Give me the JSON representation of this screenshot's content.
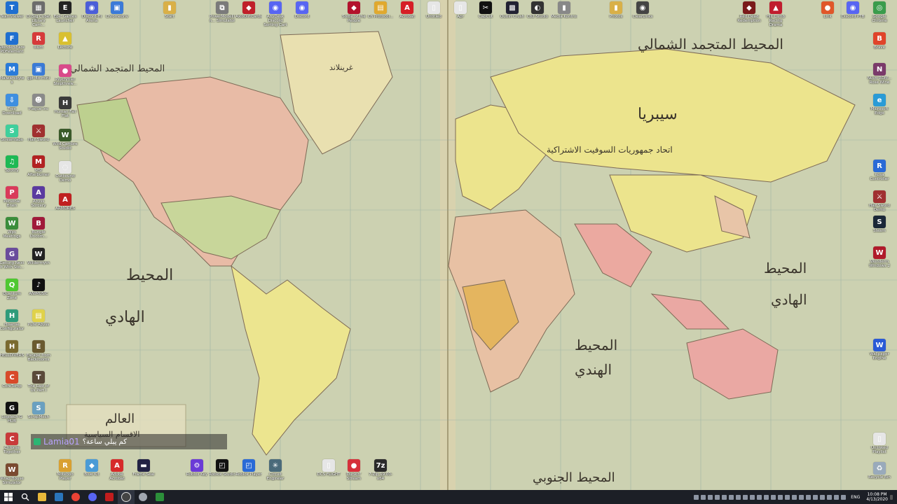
{
  "wallpaper": {
    "description_labels": {
      "north_atlantic": "المحيط المتجمد الشمالي",
      "north_atlantic_left": "المحيط المتجمد الشمالي",
      "greenland": "غرينلاند",
      "siberia": "سيبريا",
      "pacific_left_1": "المحيط",
      "pacific_left_2": "الهادي",
      "pacific_right_1": "المحيط",
      "pacific_right_2": "الهادي",
      "indian_1": "المحيط",
      "indian_2": "الهندي",
      "south_ocean": "المحيط الجنوبي",
      "title_1": "العالم",
      "title_2": "الاقسام السياسية",
      "ussr": "اتحاد جمهوريات السوفيت الاشتراكية"
    }
  },
  "desktop_icons_top": [
    {
      "label": "TeamViewer",
      "color": "#1f6fd0",
      "glyph": "T"
    },
    {
      "label": "D:\\Sig Cube\\ Library Cam...",
      "color": "#6c6c6c",
      "glyph": "▦"
    },
    {
      "label": "Epic Games Launcher",
      "color": "#222",
      "glyph": "E"
    },
    {
      "label": "Discord-Hi Arena",
      "color": "#4b5ed8",
      "glyph": "◉"
    },
    {
      "label": "Chromedriv",
      "color": "#3b7ad8",
      "glyph": "▣"
    },
    {
      "label": "Start",
      "color": "#d9b048",
      "glyph": "▮"
    },
    {
      "label": "PowerModellin... Simulator",
      "color": "#7a7a7a",
      "glyph": "⧉"
    },
    {
      "label": "AxioDirtCards",
      "color": "#c0202a",
      "glyph": "◆"
    },
    {
      "label": "AnyDesk Discord Sorting Cart",
      "color": "#5865f2",
      "glyph": "◉"
    },
    {
      "label": "Discord",
      "color": "#5865f2",
      "glyph": "◉"
    },
    {
      "label": "Some of the People",
      "color": "#b3122c",
      "glyph": "◆"
    },
    {
      "label": "Ch Protocol...",
      "color": "#e0a92f",
      "glyph": "▤"
    },
    {
      "label": "Acrobat",
      "color": "#d61f26",
      "glyph": "A"
    },
    {
      "label": "Untitled",
      "color": "#e6e6e6",
      "glyph": "▯"
    },
    {
      "label": "Apr",
      "color": "#e6e6e6",
      "glyph": "▯"
    },
    {
      "label": "CapCut",
      "color": "#111",
      "glyph": "✂"
    },
    {
      "label": "Outlin Crush",
      "color": "#223",
      "glyph": "▩"
    },
    {
      "label": "Cb2 Studio",
      "color": "#333",
      "glyph": "◐"
    },
    {
      "label": "Media Kontrol",
      "color": "#888",
      "glyph": "▮"
    },
    {
      "label": "Photos",
      "color": "#d9b048",
      "glyph": "▮"
    },
    {
      "label": "ClearLinks",
      "color": "#444",
      "glyph": "◉"
    },
    {
      "label": "Red Dead Redemption",
      "color": "#7a1a1a",
      "glyph": "◆"
    },
    {
      "label": "Hill Climb Racing Drama",
      "color": "#c01d2e",
      "glyph": "▲"
    },
    {
      "label": "Link",
      "color": "#e0572a",
      "glyph": "●"
    },
    {
      "label": "Discord PTB",
      "color": "#5865f2",
      "glyph": "◉"
    },
    {
      "label": "Google Chrome",
      "color": "#3a9c4c",
      "glyph": "◎"
    }
  ],
  "desktop_icons_left_col1": [
    {
      "label": "Wondershare PDFelement",
      "color": "#1f6fd0",
      "glyph": "F"
    },
    {
      "label": "Malwarebytes",
      "color": "#2a7bd9",
      "glyph": "M"
    },
    {
      "label": "Free Download",
      "color": "#3f8fe0",
      "glyph": "⇩"
    },
    {
      "label": "Streamlabs",
      "color": "#3fcf9c",
      "glyph": "S"
    },
    {
      "label": "Spotify",
      "color": "#1db954",
      "glyph": "♫"
    },
    {
      "label": "Personal Brain",
      "color": "#d93a5a",
      "glyph": "P"
    },
    {
      "label": "Wps Meetings",
      "color": "#3b8d3b",
      "glyph": "W"
    },
    {
      "label": "Getting Next It With Sto...",
      "color": "#6a4c9c",
      "glyph": "G"
    },
    {
      "label": "Quantum Zone",
      "color": "#4fc830",
      "glyph": "Q"
    },
    {
      "label": "Hisense Configurator",
      "color": "#2f9b7a",
      "glyph": "H"
    },
    {
      "label": "HELLDIVERS",
      "color": "#7a6a30",
      "glyph": "H"
    },
    {
      "label": "CoreTemp",
      "color": "#d84a2a",
      "glyph": "C"
    },
    {
      "label": "Logitech G HUB",
      "color": "#111",
      "glyph": "G"
    },
    {
      "label": "Chrome Together",
      "color": "#c83a3a",
      "glyph": "C"
    },
    {
      "label": "Wrap House Simulator",
      "color": "#7a4a30",
      "glyph": "W"
    }
  ],
  "desktop_icons_left_col2": [
    {
      "label": "Ilium",
      "color": "#d63a3a",
      "glyph": "R"
    },
    {
      "label": "gpt-4o-mini",
      "color": "#3a7ad6",
      "glyph": "▣"
    },
    {
      "label": "Plague Inc",
      "color": "#8a8a8a",
      "glyph": "☻"
    },
    {
      "label": "Half Sword",
      "color": "#a03030",
      "glyph": "⚔"
    },
    {
      "label": "MSI Afterburner",
      "color": "#b22222",
      "glyph": "M"
    },
    {
      "label": "Abyss Sorcery",
      "color": "#5a3aa0",
      "glyph": "A"
    },
    {
      "label": "Bungie Uncom...",
      "color": "#a01a3a",
      "glyph": "B"
    },
    {
      "label": "Wildermyth",
      "color": "#222",
      "glyph": "W"
    },
    {
      "label": "ANIMUSIC",
      "color": "#111",
      "glyph": "♪"
    },
    {
      "label": "Pure Abyss",
      "color": "#e0d24a",
      "glyph": "▤"
    },
    {
      "label": "Escape from Backrooms",
      "color": "#6a5a30",
      "glyph": "E"
    },
    {
      "label": "The Last of Us Part I",
      "color": "#5a4a3a",
      "glyph": "T"
    },
    {
      "label": "ScrapMech",
      "color": "#6aa0c0",
      "glyph": "S"
    }
  ],
  "desktop_icons_left_col3": [
    {
      "label": "Lecture",
      "color": "#d9c030",
      "glyph": "▲"
    },
    {
      "label": "Psychmiel Stepthrew...",
      "color": "#d94a8a",
      "glyph": "●"
    },
    {
      "label": "Human Fall Flat",
      "color": "#3a3a3a",
      "glyph": "H"
    },
    {
      "label": "Wild Cambre Studio",
      "color": "#3a5a2a",
      "glyph": "W"
    },
    {
      "label": "Outbound Demo",
      "color": "#e6e6e6",
      "glyph": "◌"
    },
    {
      "label": "ARMORES",
      "color": "#c02020",
      "glyph": "A"
    }
  ],
  "desktop_icons_right": [
    {
      "label": "Brave",
      "color": "#e0442a",
      "glyph": "B"
    },
    {
      "label": "Nuvo ROM... Rose Wine",
      "color": "#7a3a6a",
      "glyph": "N"
    },
    {
      "label": "Microsoft Edge",
      "color": "#2a9bd6",
      "glyph": "e"
    },
    {
      "label": "Rosa Controller",
      "color": "#2a6ad6",
      "glyph": "R"
    },
    {
      "label": "Half Sword Demo",
      "color": "#a03030",
      "glyph": "⚔"
    },
    {
      "label": "Steam",
      "color": "#1b2838",
      "glyph": "S"
    },
    {
      "label": "Wonderm Windows 2",
      "color": "#b01a2a",
      "glyph": "W"
    },
    {
      "label": "Wallpaper Engine",
      "color": "#2a5ad6",
      "glyph": "W"
    },
    {
      "label": "Unlinked Playlist",
      "color": "#e6e6e6",
      "glyph": "▯"
    },
    {
      "label": "Recycle Bin",
      "color": "#9ab",
      "glyph": "♻"
    }
  ],
  "desktop_icons_bottom": [
    {
      "label": "Noteboo Player",
      "color": "#d9a030",
      "glyph": "R"
    },
    {
      "label": "Blue Kit",
      "color": "#4a9bd6",
      "glyph": "◆"
    },
    {
      "label": "Adobe Acrobat",
      "color": "#d62a2a",
      "glyph": "A"
    },
    {
      "label": "Frame Seal",
      "color": "#224",
      "glyph": "▬"
    },
    {
      "label": "Roblox Key",
      "color": "#6a3ad6",
      "glyph": "⚙"
    },
    {
      "label": "Roblox Studio",
      "color": "#111",
      "glyph": "◰"
    },
    {
      "label": "Roblox Player",
      "color": "#2a6ad6",
      "glyph": "◰"
    },
    {
      "label": "Circuit Engineer",
      "color": "#4a6a7a",
      "glyph": "✳"
    },
    {
      "label": "DCS FLIGHT",
      "color": "#e6e6e6",
      "glyph": "▯"
    },
    {
      "label": "Dunkin' Stream",
      "color": "#d6303a",
      "glyph": "●"
    },
    {
      "label": "7-Zip 19.00-x64",
      "color": "#2a2a2a",
      "glyph": "7z"
    }
  ],
  "chat": {
    "username": "Lamia01",
    "message": "كم يبلي ساعة؟"
  },
  "taskbar": {
    "clock_time": "10:08 PM",
    "clock_date": "4/13/2020",
    "lang": "ENG"
  }
}
